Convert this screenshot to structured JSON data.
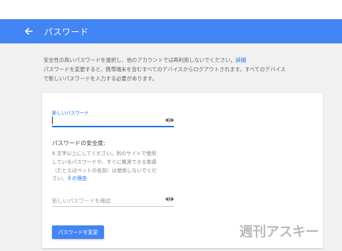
{
  "header": {
    "title": "パスワード",
    "back_icon": "arrow-back-icon",
    "color": "#4285f4"
  },
  "intro": {
    "line1": "安全性の高いパスワードを選択し、他のアカウントでは再利用しないでください。",
    "details_link": "詳細",
    "line2": "パスワードを変更すると、携帯端末を含むすべてのデバイスからログアウトされます。すべてのデバイス",
    "line3": "で新しいパスワードを入力する必要があります。"
  },
  "form": {
    "new_password_label": "新しいパスワード",
    "new_password_value": "",
    "show_password_icon": "eye-icon",
    "strength_title": "パスワードの安全度:",
    "strength_desc": [
      "8 文字以上にしてください。別のサイトで使用",
      "しているパスワードや、すぐに推測できる単語",
      "（たとえばペットの名前）は使用しないでくだ"
    ],
    "strength_desc_tail": "さい。",
    "reason_link": "その理由",
    "confirm_placeholder": "新しいパスワードを確認",
    "submit_label": "パスワードを変更"
  },
  "watermark": "週刊アスキー"
}
